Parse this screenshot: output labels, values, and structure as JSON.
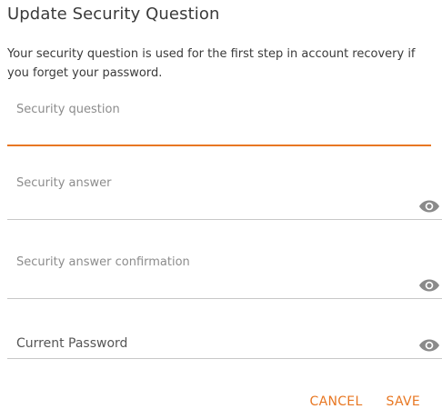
{
  "dialog": {
    "title": "Update Security Question",
    "description": "Your security question is used for the first step in account recovery if you forget your password."
  },
  "fields": {
    "security_question": {
      "label": "Security question",
      "value": "",
      "focused": true
    },
    "security_answer": {
      "label": "Security answer",
      "value": "",
      "toggle_icon": "eye-icon"
    },
    "security_answer_confirmation": {
      "label": "Security answer confirmation",
      "value": "",
      "toggle_icon": "eye-icon"
    },
    "current_password": {
      "label": "Current Password",
      "value": "",
      "toggle_icon": "eye-icon"
    }
  },
  "actions": {
    "cancel_label": "CANCEL",
    "save_label": "SAVE"
  },
  "colors": {
    "accent": "#e87722",
    "underline": "#c8c8c8",
    "label": "#8c8c8c",
    "eye": "#8a8a8a"
  }
}
